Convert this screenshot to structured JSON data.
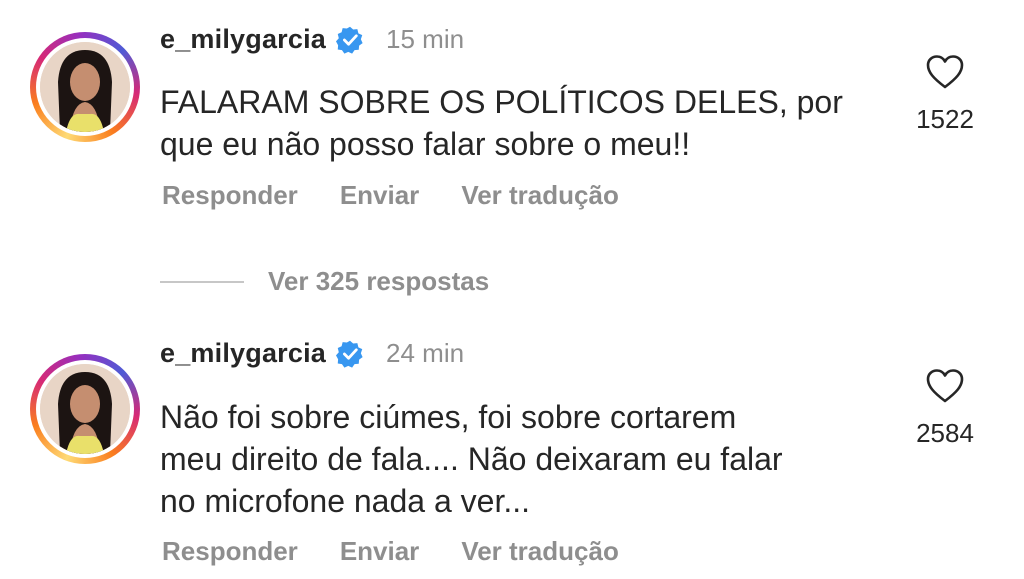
{
  "comments": [
    {
      "username": "e_milygarcia",
      "time": "15 min",
      "text_lines": [
        "FALARAM SOBRE OS POLÍTICOS DELES, por",
        "que eu não posso falar sobre o meu!!"
      ],
      "likes": "1522",
      "actions": {
        "reply": "Responder",
        "send": "Enviar",
        "translate": "Ver tradução"
      }
    },
    {
      "username": "e_milygarcia",
      "time": "24 min",
      "text_lines": [
        "Não foi sobre ciúmes, foi sobre cortarem",
        "meu direito de fala.... Não deixaram eu falar",
        "no microfone nada a ver..."
      ],
      "likes": "2584",
      "actions": {
        "reply": "Responder",
        "send": "Enviar",
        "translate": "Ver tradução"
      }
    }
  ],
  "view_replies": "Ver 325 respostas",
  "icons": {
    "verified": "verified-badge-icon",
    "like": "heart-icon"
  },
  "colors": {
    "verified": "#3897f0",
    "muted": "#8e8e8e",
    "text": "#262626"
  }
}
